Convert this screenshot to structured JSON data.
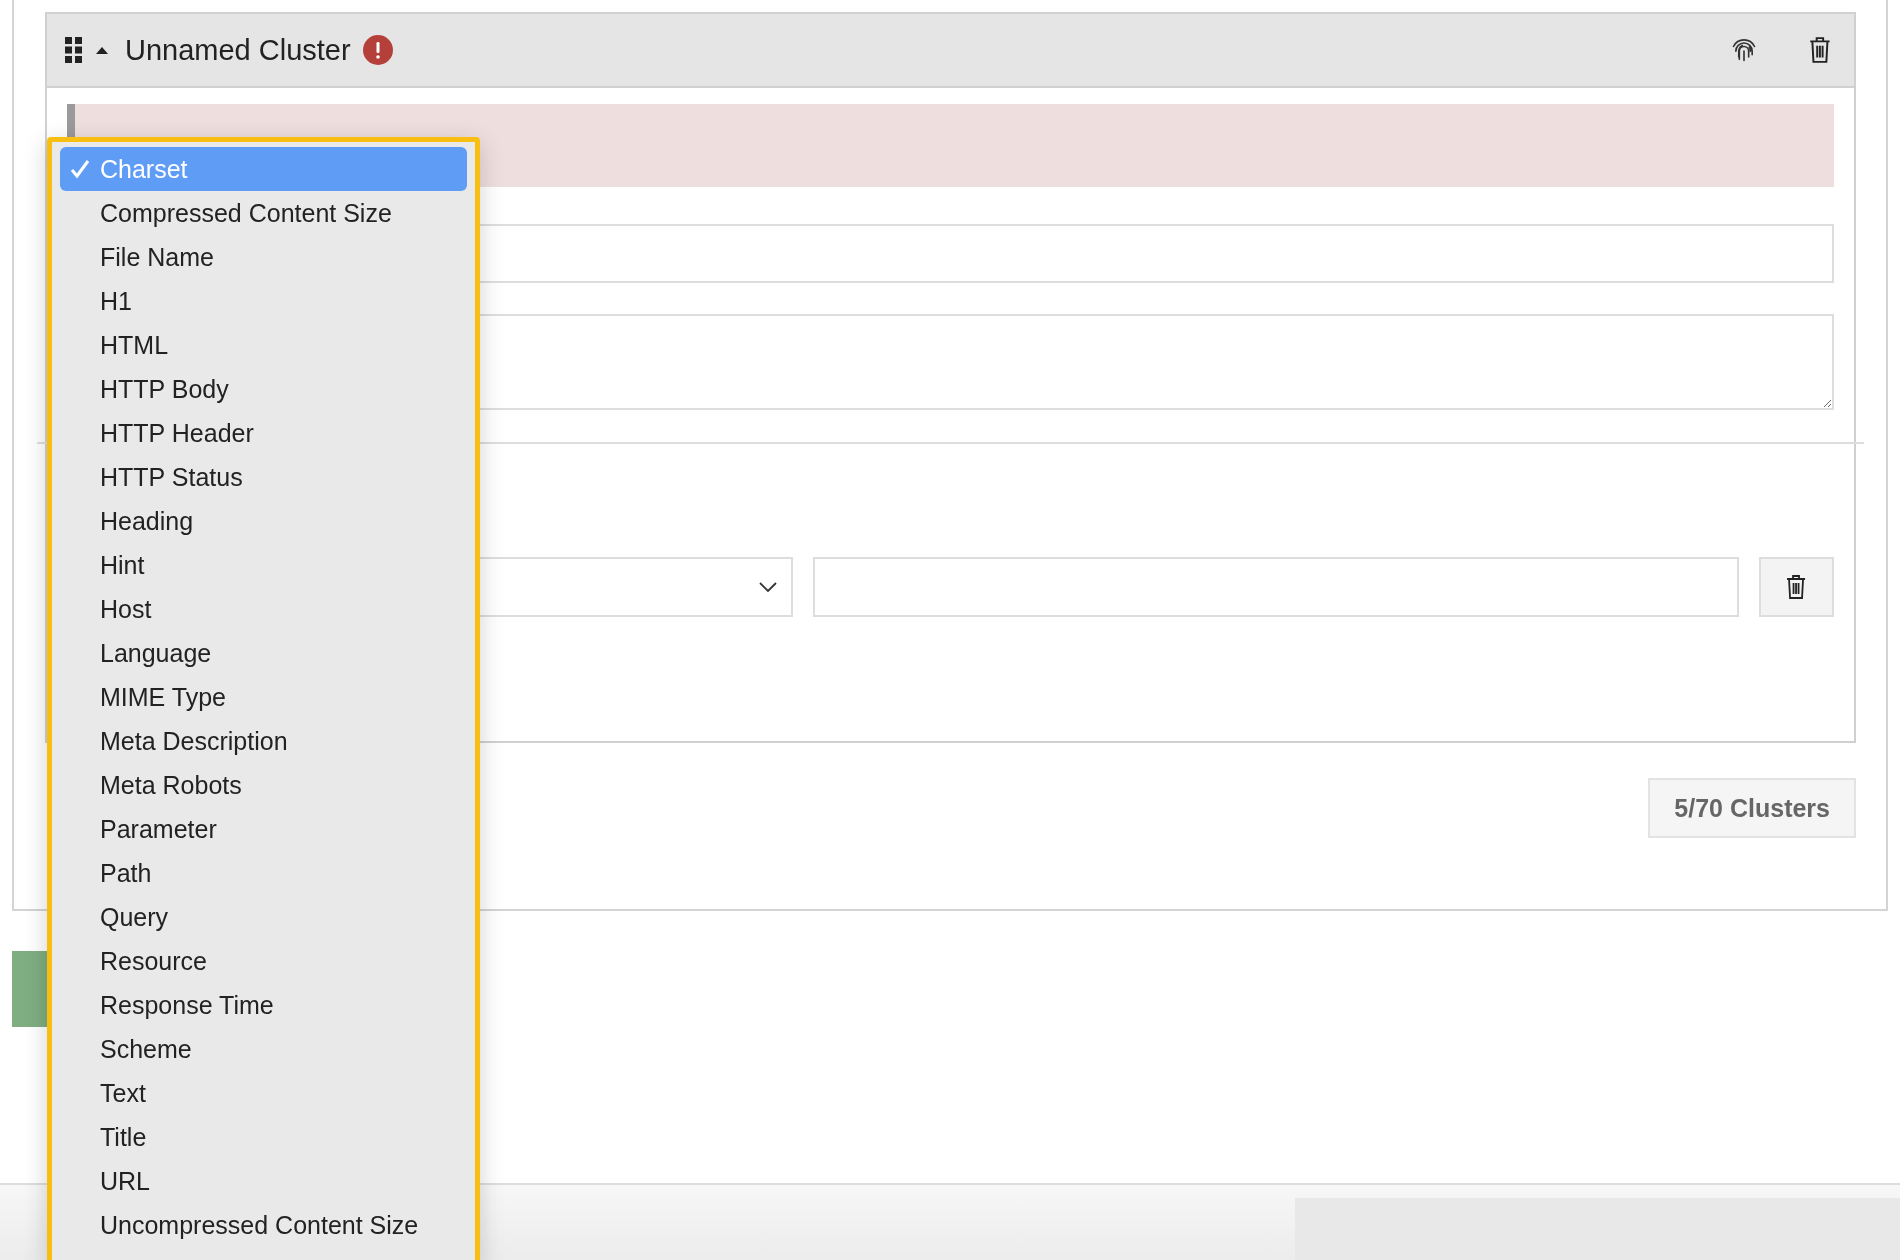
{
  "cluster": {
    "title": "Unnamed Cluster",
    "expanded": true,
    "has_error": true
  },
  "cluster_count": "5/70 Clusters",
  "dropdown": {
    "options": [
      {
        "label": "Charset",
        "selected": true
      },
      {
        "label": "Compressed Content Size",
        "selected": false
      },
      {
        "label": "File Name",
        "selected": false
      },
      {
        "label": "H1",
        "selected": false
      },
      {
        "label": "HTML",
        "selected": false
      },
      {
        "label": "HTTP Body",
        "selected": false
      },
      {
        "label": "HTTP Header",
        "selected": false
      },
      {
        "label": "HTTP Status",
        "selected": false
      },
      {
        "label": "Heading",
        "selected": false
      },
      {
        "label": "Hint",
        "selected": false
      },
      {
        "label": "Host",
        "selected": false
      },
      {
        "label": "Language",
        "selected": false
      },
      {
        "label": "MIME Type",
        "selected": false
      },
      {
        "label": "Meta Description",
        "selected": false
      },
      {
        "label": "Meta Robots",
        "selected": false
      },
      {
        "label": "Parameter",
        "selected": false
      },
      {
        "label": "Path",
        "selected": false
      },
      {
        "label": "Query",
        "selected": false
      },
      {
        "label": "Resource",
        "selected": false
      },
      {
        "label": "Response Time",
        "selected": false
      },
      {
        "label": "Scheme",
        "selected": false
      },
      {
        "label": "Text",
        "selected": false
      },
      {
        "label": "Title",
        "selected": false
      },
      {
        "label": "URL",
        "selected": false
      },
      {
        "label": "Uncompressed Content Size",
        "selected": false
      }
    ]
  }
}
